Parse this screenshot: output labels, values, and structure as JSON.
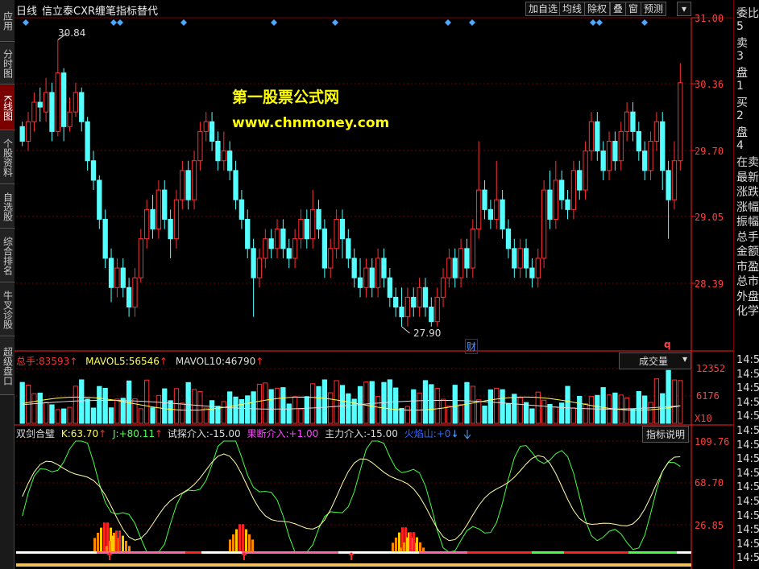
{
  "sidebar": {
    "tabs": [
      {
        "label": "应用",
        "active": false
      },
      {
        "label": "分时图",
        "active": false
      },
      {
        "label": "K线图",
        "active": true
      },
      {
        "label": "个股资料",
        "active": false
      },
      {
        "label": "自选股",
        "active": false
      },
      {
        "label": "综合排名",
        "active": false
      },
      {
        "label": "牛叉诊股",
        "active": false
      },
      {
        "label": "超级盘口",
        "active": false
      }
    ]
  },
  "header": {
    "period": "日线",
    "stock_name": "信立泰",
    "indicator": "CXR缠笔指标替代",
    "buttons": [
      "加自选",
      "均线",
      "除权",
      "叠",
      "窗",
      "预测"
    ],
    "more": "▾"
  },
  "watermark": {
    "line1": "第一股票公式网",
    "line2": "www.chnmoney.com"
  },
  "price_axis": {
    "ticks": [
      "31.00",
      "30.36",
      "29.70",
      "29.05",
      "28.39"
    ],
    "accent": "#ff2020"
  },
  "price_chart": {
    "high_label": "30.84",
    "low_label": "27.90",
    "event_marker": "财",
    "q_marker": "q",
    "up_color": "#ff3030",
    "down_color": "#54ffff"
  },
  "volume_panel": {
    "label_total": "总手:",
    "total_value": "83593",
    "mavol5_label": "MAVOL5:",
    "mavol5_value": "56546",
    "mavol10_label": "MAVOL10:",
    "mavol10_value": "46790",
    "arrow": "↑",
    "dropdown": "成交量",
    "axis": [
      "12352",
      "6176",
      "X10"
    ]
  },
  "indicator_panel": {
    "name": "双剑合璧",
    "k_label": "K:",
    "k_value": "63.70",
    "j_label": "J:",
    "j_value": "+80.11",
    "s1_label": "试探介入:",
    "s1_value": "-15.00",
    "s2_label": "果断介入:",
    "s2_value": "+1.00",
    "s3_label": "主力介入:",
    "s3_value": "-15.00",
    "s4_label": "火焰山:",
    "s4_value": "+0",
    "help_button": "指标说明",
    "axis": [
      "109.76",
      "68.70",
      "26.85"
    ]
  },
  "right_panel": {
    "rows": [
      "委比",
      "5",
      "卖",
      "3",
      "盘",
      "1",
      "买",
      "2",
      "盘",
      "4",
      "在卖",
      "最新",
      "涨跌",
      "涨幅",
      "振幅",
      "总手",
      "金额",
      "市盈",
      "总市",
      "外盘",
      "化学"
    ],
    "times": [
      "14:5",
      "14:5",
      "14:5",
      "14:5",
      "14:5",
      "14:5",
      "14:5",
      "14:5",
      "14:5",
      "14:5",
      "14:5",
      "14:5",
      "14:5",
      "14:5",
      "14:5"
    ]
  },
  "chart_data": {
    "type": "candlestick",
    "ylim": [
      27.7,
      31.05
    ],
    "candles": [
      [
        29.95,
        29.8,
        30.0,
        29.75
      ],
      [
        29.8,
        30.0,
        30.1,
        29.7
      ],
      [
        30.0,
        30.2,
        30.3,
        29.9
      ],
      [
        30.2,
        30.15,
        30.35,
        30.0
      ],
      [
        30.1,
        30.3,
        30.45,
        30.0
      ],
      [
        30.3,
        29.9,
        30.4,
        29.8
      ],
      [
        29.9,
        30.5,
        30.84,
        29.85
      ],
      [
        30.5,
        29.95,
        30.55,
        29.8
      ],
      [
        29.95,
        30.1,
        30.25,
        29.9
      ],
      [
        30.1,
        30.3,
        30.4,
        30.05
      ],
      [
        30.3,
        30.0,
        30.35,
        29.9
      ],
      [
        30.0,
        29.6,
        30.05,
        29.5
      ],
      [
        29.6,
        29.4,
        29.7,
        29.3
      ],
      [
        29.4,
        29.0,
        29.45,
        28.9
      ],
      [
        29.0,
        28.6,
        29.1,
        28.5
      ],
      [
        28.6,
        28.3,
        28.7,
        28.15
      ],
      [
        28.3,
        28.5,
        28.6,
        28.2
      ],
      [
        28.5,
        28.3,
        28.6,
        28.2
      ],
      [
        28.3,
        28.1,
        28.4,
        28.0
      ],
      [
        28.1,
        28.4,
        28.5,
        28.0
      ],
      [
        28.4,
        28.8,
        28.9,
        28.35
      ],
      [
        28.8,
        29.1,
        29.2,
        28.7
      ],
      [
        29.1,
        28.9,
        29.25,
        28.8
      ],
      [
        28.9,
        29.3,
        29.4,
        28.8
      ],
      [
        29.3,
        29.0,
        29.4,
        28.9
      ],
      [
        29.0,
        28.8,
        29.1,
        28.6
      ],
      [
        28.8,
        29.2,
        29.3,
        28.7
      ],
      [
        29.2,
        29.5,
        29.6,
        29.1
      ],
      [
        29.5,
        29.2,
        29.6,
        29.1
      ],
      [
        29.2,
        29.6,
        29.7,
        29.1
      ],
      [
        29.6,
        29.9,
        30.0,
        29.5
      ],
      [
        29.9,
        30.0,
        30.1,
        29.8
      ],
      [
        30.0,
        29.8,
        30.1,
        29.7
      ],
      [
        29.8,
        29.6,
        29.9,
        29.5
      ],
      [
        29.6,
        29.7,
        29.9,
        29.5
      ],
      [
        29.7,
        29.5,
        29.8,
        29.4
      ],
      [
        29.5,
        29.2,
        29.6,
        29.1
      ],
      [
        29.2,
        29.0,
        29.3,
        28.9
      ],
      [
        29.0,
        28.7,
        29.1,
        28.6
      ],
      [
        28.7,
        28.4,
        28.8,
        28.0
      ],
      [
        28.4,
        28.6,
        28.7,
        28.3
      ],
      [
        28.6,
        28.8,
        28.9,
        28.5
      ],
      [
        28.8,
        28.7,
        28.9,
        28.6
      ],
      [
        28.7,
        28.9,
        29.0,
        28.6
      ],
      [
        28.9,
        28.7,
        29.0,
        28.6
      ],
      [
        28.7,
        28.6,
        28.8,
        28.5
      ],
      [
        28.6,
        28.8,
        28.9,
        28.5
      ],
      [
        28.8,
        29.0,
        29.1,
        28.7
      ],
      [
        29.0,
        28.8,
        29.1,
        28.7
      ],
      [
        28.8,
        29.1,
        29.3,
        28.7
      ],
      [
        29.1,
        28.9,
        29.2,
        28.8
      ],
      [
        28.9,
        28.5,
        29.0,
        28.4
      ],
      [
        28.5,
        28.7,
        28.8,
        28.4
      ],
      [
        28.7,
        29.0,
        29.1,
        28.6
      ],
      [
        29.0,
        28.8,
        29.1,
        28.6
      ],
      [
        28.8,
        28.6,
        28.9,
        28.5
      ],
      [
        28.6,
        28.4,
        28.7,
        28.3
      ],
      [
        28.4,
        28.3,
        28.6,
        28.2
      ],
      [
        28.3,
        28.5,
        28.6,
        28.2
      ],
      [
        28.5,
        28.3,
        28.6,
        28.2
      ],
      [
        28.3,
        28.6,
        28.7,
        28.2
      ],
      [
        28.6,
        28.4,
        28.7,
        28.3
      ],
      [
        28.4,
        28.2,
        28.5,
        28.1
      ],
      [
        28.2,
        28.1,
        28.3,
        28.0
      ],
      [
        28.1,
        28.0,
        28.3,
        27.9
      ],
      [
        28.0,
        28.2,
        28.3,
        27.9
      ],
      [
        28.2,
        28.1,
        28.3,
        28.0
      ],
      [
        28.1,
        28.3,
        28.4,
        28.0
      ],
      [
        28.3,
        28.1,
        28.4,
        28.0
      ],
      [
        28.1,
        27.95,
        28.2,
        27.9
      ],
      [
        27.95,
        28.2,
        28.3,
        27.9
      ],
      [
        28.2,
        28.4,
        28.5,
        28.1
      ],
      [
        28.4,
        28.6,
        28.7,
        28.3
      ],
      [
        28.6,
        28.4,
        28.7,
        28.3
      ],
      [
        28.4,
        28.7,
        28.8,
        28.3
      ],
      [
        28.7,
        28.5,
        28.8,
        28.4
      ],
      [
        28.5,
        28.9,
        29.0,
        28.4
      ],
      [
        28.9,
        29.3,
        29.8,
        28.8
      ],
      [
        29.3,
        29.1,
        29.4,
        29.0
      ],
      [
        29.1,
        29.0,
        29.2,
        28.9
      ],
      [
        29.0,
        29.2,
        29.6,
        28.9
      ],
      [
        29.2,
        28.9,
        29.3,
        28.8
      ],
      [
        28.9,
        28.7,
        29.0,
        28.6
      ],
      [
        28.7,
        28.5,
        28.8,
        28.4
      ],
      [
        28.5,
        28.7,
        28.8,
        28.4
      ],
      [
        28.7,
        28.5,
        28.8,
        28.4
      ],
      [
        28.5,
        28.4,
        28.6,
        28.3
      ],
      [
        28.4,
        28.6,
        28.7,
        28.3
      ],
      [
        28.6,
        29.3,
        29.4,
        28.5
      ],
      [
        29.3,
        29.0,
        29.5,
        28.9
      ],
      [
        29.0,
        29.4,
        29.6,
        28.9
      ],
      [
        29.4,
        29.2,
        29.5,
        29.1
      ],
      [
        29.2,
        29.1,
        29.3,
        29.0
      ],
      [
        29.1,
        29.5,
        29.6,
        29.0
      ],
      [
        29.5,
        29.3,
        29.6,
        29.2
      ],
      [
        29.3,
        29.7,
        29.8,
        29.2
      ],
      [
        29.7,
        30.0,
        30.1,
        29.6
      ],
      [
        30.0,
        29.7,
        30.1,
        29.6
      ],
      [
        29.7,
        29.5,
        29.8,
        29.4
      ],
      [
        29.5,
        29.8,
        29.9,
        29.4
      ],
      [
        29.8,
        29.6,
        29.9,
        29.5
      ],
      [
        29.6,
        29.9,
        30.0,
        29.5
      ],
      [
        29.9,
        30.1,
        30.2,
        29.8
      ],
      [
        30.1,
        29.9,
        30.2,
        29.8
      ],
      [
        29.9,
        29.7,
        30.0,
        29.6
      ],
      [
        29.7,
        29.5,
        29.8,
        29.4
      ],
      [
        29.5,
        29.8,
        29.9,
        29.4
      ],
      [
        29.8,
        30.0,
        30.1,
        29.7
      ],
      [
        30.0,
        29.5,
        30.1,
        29.3
      ],
      [
        29.5,
        29.2,
        29.6,
        28.8
      ],
      [
        29.2,
        29.6,
        29.8,
        29.1
      ],
      [
        29.6,
        30.4,
        30.6,
        29.5
      ]
    ]
  }
}
